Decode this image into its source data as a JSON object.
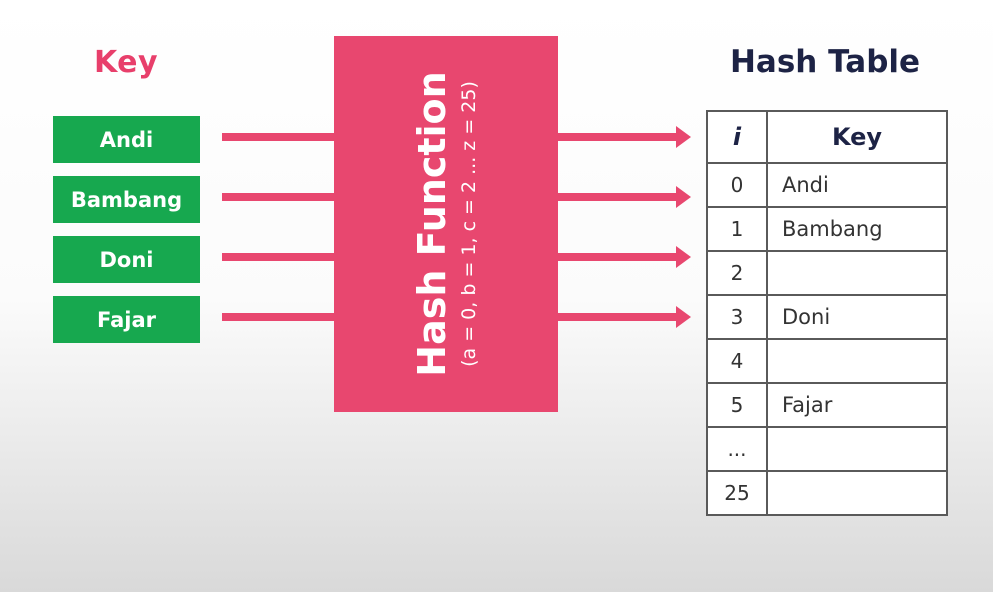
{
  "keys": {
    "title": "Key",
    "items": [
      "Andi",
      "Bambang",
      "Doni",
      "Fajar"
    ]
  },
  "hash_function": {
    "title": "Hash Function",
    "formula": "(a = 0, b = 1, c = 2 ... z = 25)"
  },
  "hash_table": {
    "title": "Hash Table",
    "headers": [
      "i",
      "Key"
    ],
    "rows": [
      {
        "i": "0",
        "key": "Andi"
      },
      {
        "i": "1",
        "key": "Bambang"
      },
      {
        "i": "2",
        "key": ""
      },
      {
        "i": "3",
        "key": "Doni"
      },
      {
        "i": "4",
        "key": ""
      },
      {
        "i": "5",
        "key": "Fajar"
      },
      {
        "i": "...",
        "key": ""
      },
      {
        "i": "25",
        "key": ""
      }
    ]
  },
  "colors": {
    "key_title": "#e83f6b",
    "key_box": "#17a84f",
    "hash_box": "#e8476f",
    "arrow": "#e8476f",
    "table_title": "#1d2345"
  }
}
